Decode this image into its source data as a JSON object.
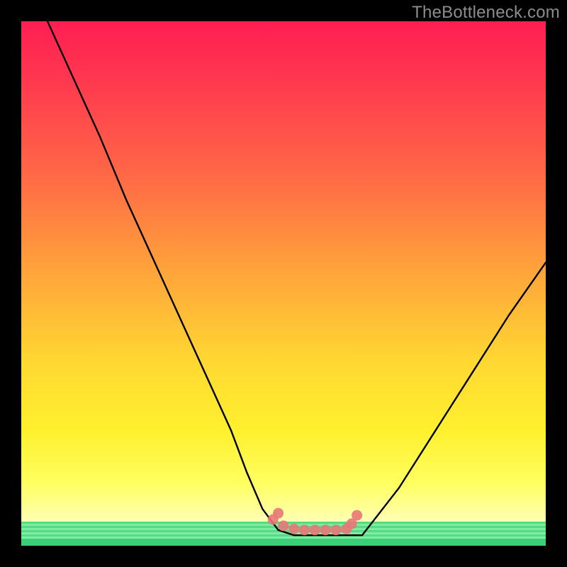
{
  "watermark": "TheBottleneck.com",
  "chart_data": {
    "type": "line",
    "title": "",
    "xlabel": "",
    "ylabel": "",
    "xlim": [
      0,
      100
    ],
    "ylim": [
      0,
      100
    ],
    "grid": false,
    "legend": false,
    "series": [
      {
        "name": "curve",
        "x": [
          5,
          10,
          15,
          20,
          25,
          30,
          35,
          40,
          43,
          46,
          49,
          52,
          55,
          58,
          61,
          65,
          72,
          79,
          86,
          93,
          100
        ],
        "values": [
          100,
          89,
          78,
          66,
          55,
          44,
          33,
          22,
          14,
          7,
          3,
          2,
          2,
          2,
          2,
          2,
          11,
          22,
          33,
          44,
          54
        ]
      }
    ],
    "markers": [
      {
        "x": 48,
        "y": 5.0
      },
      {
        "x": 50,
        "y": 3.8
      },
      {
        "x": 52,
        "y": 3.2
      },
      {
        "x": 54,
        "y": 3.0
      },
      {
        "x": 56,
        "y": 3.0
      },
      {
        "x": 58,
        "y": 3.0
      },
      {
        "x": 60,
        "y": 3.0
      },
      {
        "x": 62,
        "y": 3.2
      },
      {
        "x": 63,
        "y": 4.2
      },
      {
        "x": 64,
        "y": 5.8
      },
      {
        "x": 49,
        "y": 6.2
      }
    ],
    "colors": {
      "curve": "#000000",
      "markers": "#e87777",
      "gradient_top": "#ff1e52",
      "gradient_bottom": "#ffffe0",
      "horizon": "#18c767"
    }
  }
}
